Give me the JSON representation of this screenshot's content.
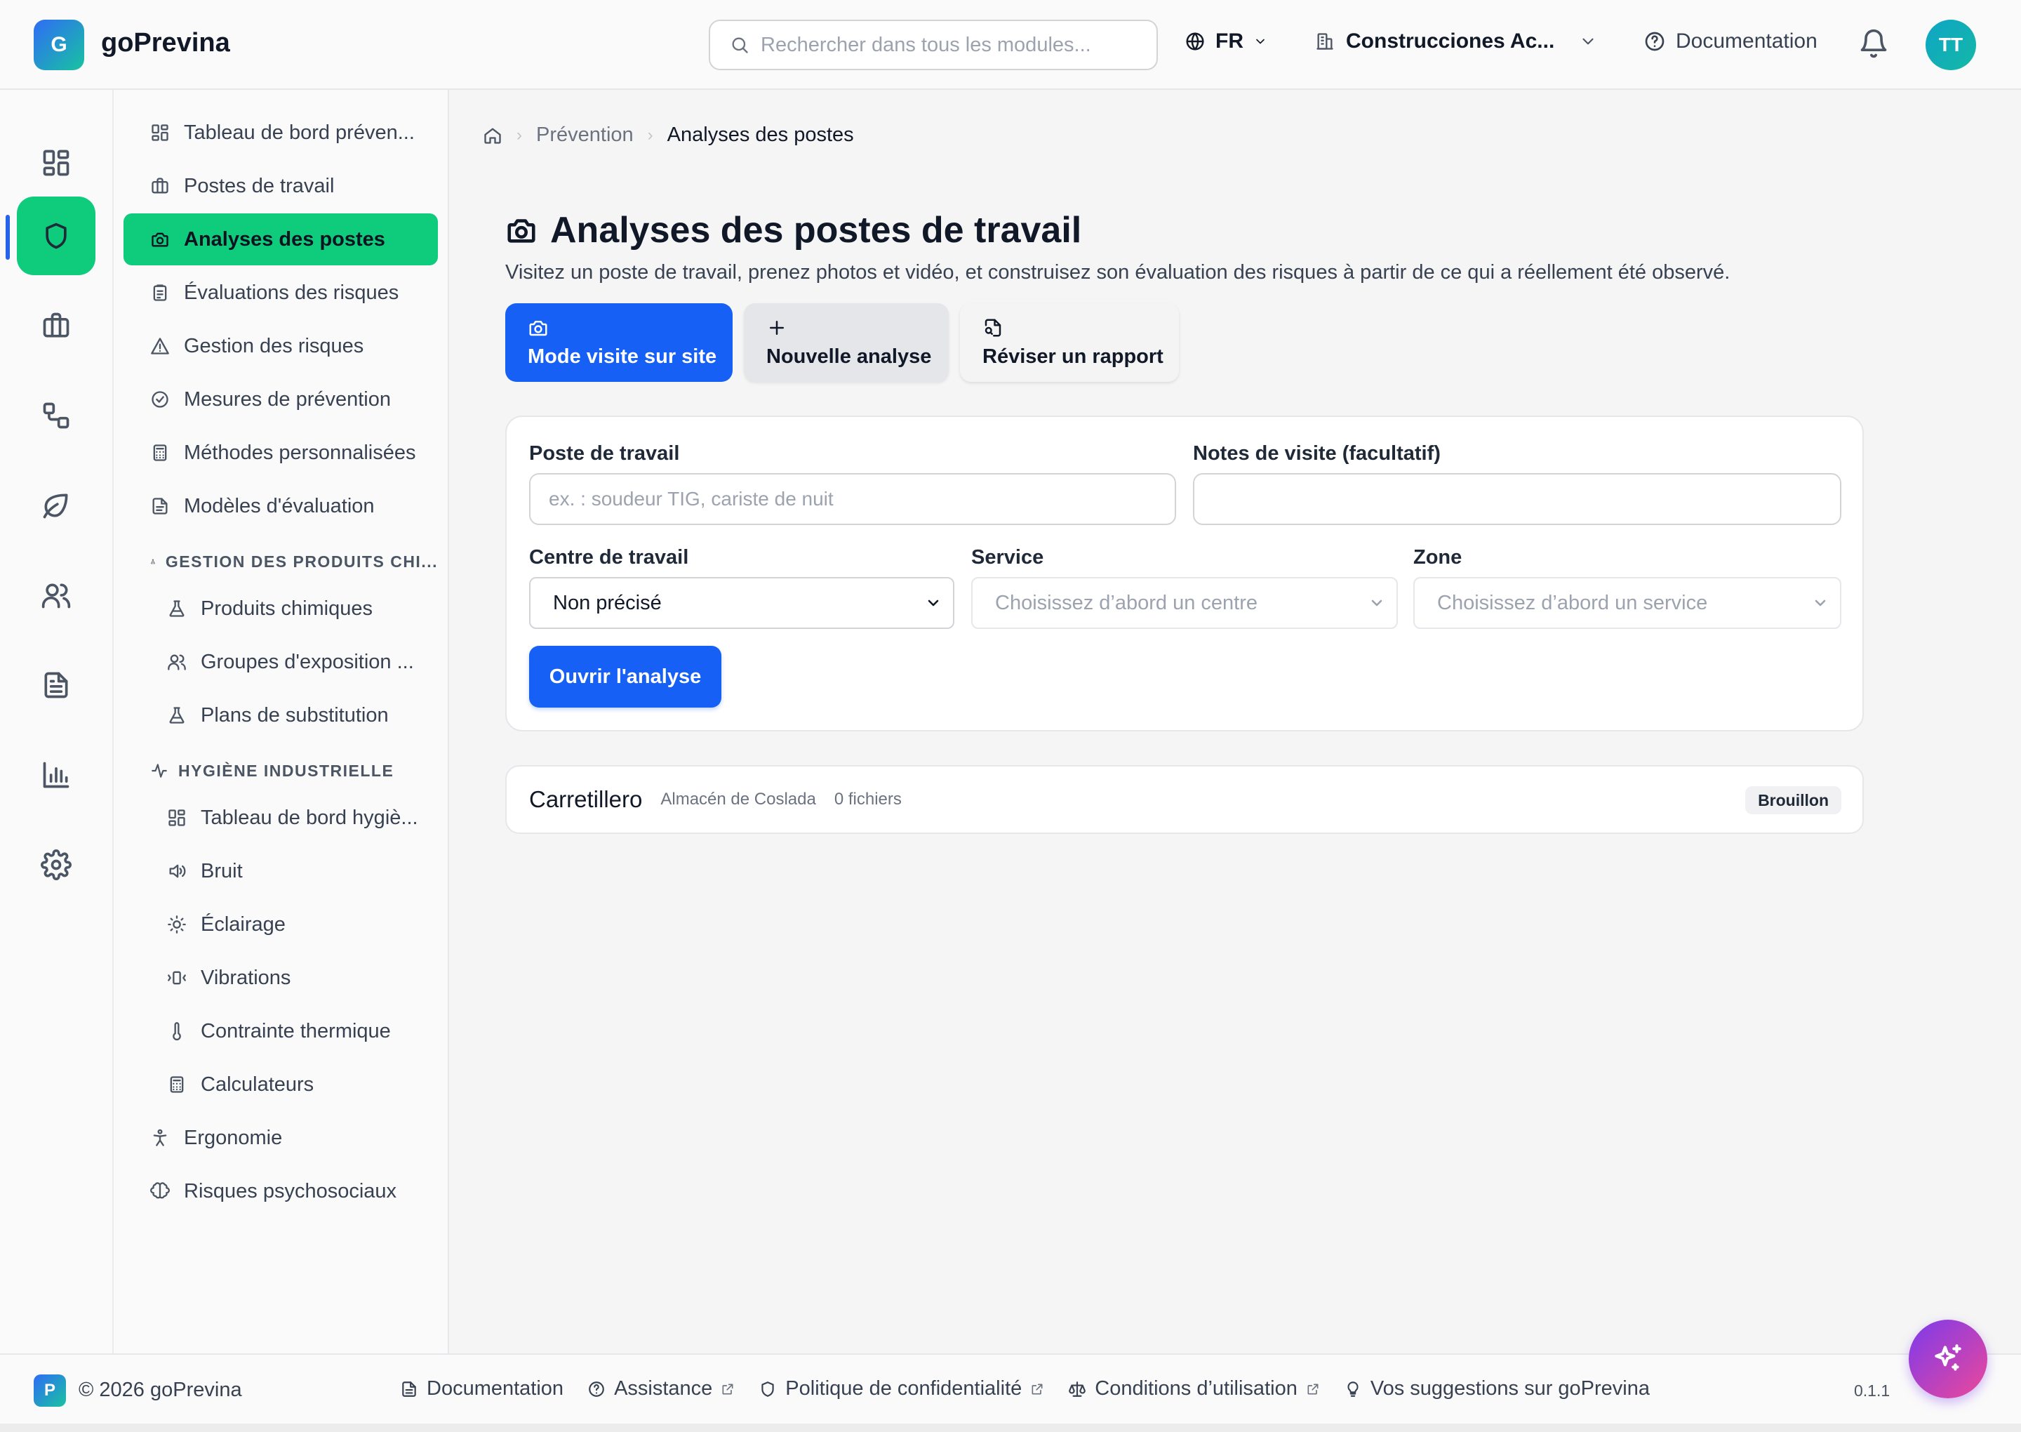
{
  "app": {
    "logo_letter": "G",
    "name": "goPrevina"
  },
  "topbar": {
    "search_placeholder": "Rechercher dans tous les modules...",
    "language": "FR",
    "company": "Construcciones Ac...",
    "documentation": "Documentation",
    "user_initials": "TT"
  },
  "rail": {
    "items": [
      {
        "icon": "layout-grid-icon",
        "active": false
      },
      {
        "icon": "shield-icon",
        "active": true
      },
      {
        "icon": "briefcase-icon",
        "active": false
      },
      {
        "icon": "workflow-icon",
        "active": false
      },
      {
        "icon": "leaf-icon",
        "active": false
      },
      {
        "icon": "users-icon",
        "active": false
      },
      {
        "icon": "file-text-icon",
        "active": false
      },
      {
        "icon": "bar-chart-icon",
        "active": false
      },
      {
        "icon": "gear-icon",
        "active": false
      }
    ]
  },
  "subnav": {
    "items": [
      {
        "label": "Tableau de bord préven...",
        "icon": "layout-grid-icon"
      },
      {
        "label": "Postes de travail",
        "icon": "briefcase-icon"
      },
      {
        "label": "Analyses des postes",
        "icon": "camera-icon",
        "active": true
      },
      {
        "label": "Évaluations des risques",
        "icon": "clipboard-icon"
      },
      {
        "label": "Gestion des risques",
        "icon": "warning-icon"
      },
      {
        "label": "Mesures de prévention",
        "icon": "check-circle-icon"
      },
      {
        "label": "Méthodes personnalisées",
        "icon": "calculator-icon"
      },
      {
        "label": "Modèles d'évaluation",
        "icon": "file-icon"
      }
    ],
    "section_chemicals": {
      "title": "GESTION DES PRODUITS CHI...",
      "items": [
        {
          "label": "Produits chimiques",
          "icon": "flask-icon"
        },
        {
          "label": "Groupes d'exposition ...",
          "icon": "users-icon"
        },
        {
          "label": "Plans de substitution",
          "icon": "flask-icon"
        }
      ]
    },
    "section_hygiene": {
      "title": "HYGIÈNE INDUSTRIELLE",
      "items": [
        {
          "label": "Tableau de bord hygiè...",
          "icon": "layout-grid-icon"
        },
        {
          "label": "Bruit",
          "icon": "speaker-icon"
        },
        {
          "label": "Éclairage",
          "icon": "sun-icon"
        },
        {
          "label": "Vibrations",
          "icon": "vibrate-icon"
        },
        {
          "label": "Contrainte thermique",
          "icon": "thermometer-icon"
        },
        {
          "label": "Calculateurs",
          "icon": "calculator-icon"
        }
      ]
    },
    "bottom_items": [
      {
        "label": "Ergonomie",
        "icon": "person-icon"
      },
      {
        "label": "Risques psychosociaux",
        "icon": "brain-icon"
      }
    ]
  },
  "breadcrumb": {
    "parent": "Prévention",
    "current": "Analyses des postes"
  },
  "page": {
    "title": "Analyses des postes de travail",
    "subtitle": "Visitez un poste de travail, prenez photos et vidéo, et construisez son évaluation des risques à partir de ce qui a réellement été observé."
  },
  "actions": {
    "site_visit": "Mode visite sur site",
    "new_analysis": "Nouvelle analyse",
    "review_report": "Réviser un rapport"
  },
  "form": {
    "workstation_label": "Poste de travail",
    "workstation_placeholder": "ex. : soudeur TIG, cariste de nuit",
    "workstation_value": "",
    "notes_label": "Notes de visite (facultatif)",
    "notes_value": "",
    "center_label": "Centre de travail",
    "center_value": "Non précisé",
    "service_label": "Service",
    "service_value": "Choisissez d’abord un centre",
    "zone_label": "Zone",
    "zone_value": "Choisissez d’abord un service",
    "submit": "Ouvrir l'analyse"
  },
  "analyses": [
    {
      "title": "Carretillero",
      "location": "Almacén de Coslada",
      "files": "0 fichiers",
      "status": "Brouillon"
    }
  ],
  "footer": {
    "logo_letter": "P",
    "copyright": "© 2026 goPrevina",
    "links": {
      "documentation": "Documentation",
      "assistance": "Assistance",
      "privacy": "Politique de confidentialité",
      "terms": "Conditions d’utilisation",
      "feedback": "Vos suggestions sur goPrevina"
    },
    "version": "0.1.1"
  },
  "colors": {
    "brand_green": "#0fcb7c",
    "primary_blue": "#1660f5",
    "rail_indicator": "#2563eb",
    "fab_gradient": [
      "#7c3aed",
      "#ec4899"
    ]
  }
}
